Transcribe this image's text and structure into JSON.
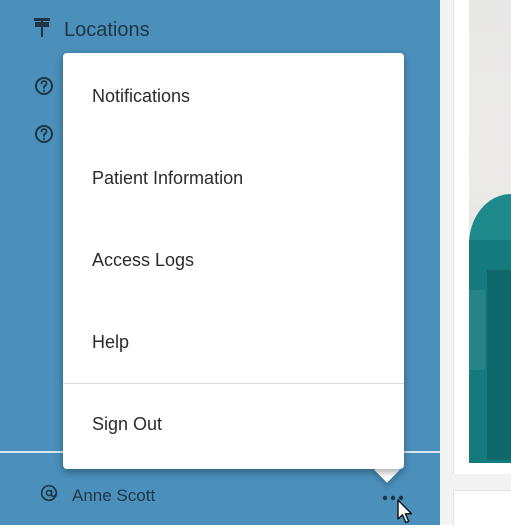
{
  "sidebar": {
    "locations_label": "Locations",
    "icons": [
      "signpost-icon",
      "help-icon",
      "help-icon"
    ]
  },
  "user": {
    "name": "Anne Scott",
    "icon": "at-icon",
    "more_icon": "ellipsis-icon"
  },
  "menu": {
    "items": [
      {
        "label": "Notifications"
      },
      {
        "label": "Patient Information"
      },
      {
        "label": "Access Logs"
      },
      {
        "label": "Help"
      },
      {
        "label": "Sign Out"
      }
    ]
  },
  "colors": {
    "sidebar_bg": "#4a90bb",
    "sidebar_text": "#1f3545",
    "menu_bg": "#ffffff",
    "menu_text": "#2b2b2b",
    "scrub_teal": "#147a7d"
  }
}
